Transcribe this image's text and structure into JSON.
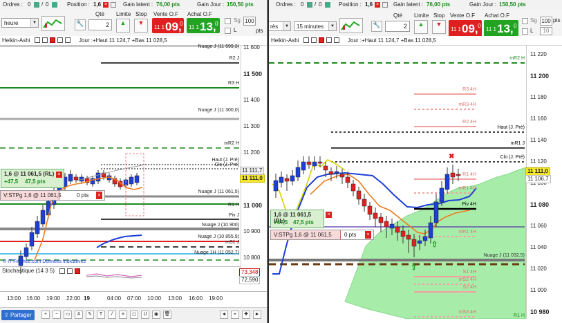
{
  "left": {
    "topbar": {
      "orders_label": "Ordres :",
      "orders_a": "0",
      "orders_b": "0",
      "position_label": "Position :",
      "position_val": "1,6",
      "gain_latent_label": "Gain latent :",
      "gain_latent_val": "76,00 pts",
      "gain_jour_label": "Gain Jour :",
      "gain_jour_val": "150,50 pts"
    },
    "toolbar": {
      "timeframe": "heure",
      "qte_label": "Qté",
      "qte_value": "2",
      "limite_label": "Limite",
      "stop_label": "Stop",
      "vente_label": "Vente O.F",
      "achat_label": "Achat O.F",
      "vente_small": "11 1",
      "vente_big": "09,",
      "vente_sup": "0",
      "achat_small": "11 1",
      "achat_big": "13,",
      "achat_sup": "0",
      "sg_label": "Sg",
      "l_label": "L",
      "pts_value": "100",
      "pts_label": "pts"
    },
    "chart_header": {
      "name": "Heikin-Ashi",
      "info": "Jour :+Haut 11 124,7 +Bas 11 028,5"
    },
    "axis_ticks": [
      "11 600",
      "11 500",
      "11 400",
      "11 300",
      "11 200",
      "11 100",
      "11 000",
      "10 900",
      "10 800"
    ],
    "price_flag": "11 111,0",
    "price_gray": "11 111,7",
    "price_red_a": "73,348",
    "price_red_b": "72,590",
    "levels": [
      "Nuage J (11 599,3)",
      "R2 J",
      "R3 H",
      "Nuage J (11 300,0)",
      "mR2 H",
      "Haut (J. Pré)",
      "Clo (J. Pré)",
      "Nuage J (11 061,5)",
      "R1 H",
      "Piv J",
      "Nuage J (10 900)",
      "Nuage J (10 855,9)",
      "mS1 J",
      "Nuage 1H (11 052,7)"
    ],
    "position": {
      "line1": "1,6 @ 11 061,5 (RL)",
      "gain": "+47,5",
      "gain_pts": "47,5 pts"
    },
    "stop": {
      "text": "V:STPg  1,6 @ 11 061,5",
      "pts": "0 pts"
    },
    "watermark": "© IT-Finance.com Données indicatives",
    "stoch_label": "Stochastique (14 3 5)",
    "times": [
      "13:00",
      "16:00",
      "19:00",
      "22:00",
      "19",
      "04:00",
      "07:00",
      "10:00",
      "13:00",
      "16:00",
      "19:00"
    ],
    "partager": "Partager"
  },
  "right": {
    "topbar": {
      "orders_label": "Ordres :",
      "orders_a": "0",
      "orders_b": "0",
      "position_label": "Position :",
      "position_val": "1,6",
      "gain_latent_label": "Gain latent :",
      "gain_latent_val": "76,00 pts",
      "gain_jour_label": "Gain Jour :",
      "gain_jour_val": "150,50 pts"
    },
    "toolbar": {
      "timeframe_left": "rès",
      "timeframe": "15 minutes",
      "qte_label": "Qté",
      "qte_value": "2",
      "limite_label": "Limite",
      "stop_label": "Stop",
      "vente_label": "Vente O.F",
      "achat_label": "Achat O.F",
      "vente_small": "11 1",
      "vente_big": "09,",
      "vente_sup": "0",
      "achat_small": "11 1",
      "achat_big": "13,",
      "achat_sup": "0",
      "sg_label": "Sg",
      "l_label": "L",
      "pts_value": "100",
      "pts_value2": "10",
      "pts_label": "pts"
    },
    "chart_header": {
      "name": "Heikin-Ashi",
      "info": "Jour :+Haut 11 124,7 +Bas 11 028,5"
    },
    "axis_ticks": [
      "11 220",
      "11 200",
      "11 180",
      "11 160",
      "11 140",
      "11 120",
      "11 100",
      "11 080",
      "11 060",
      "11 040",
      "11 020",
      "11 000",
      "10 980"
    ],
    "price_flag": "11 111,0",
    "price_gray": "11 106,7",
    "levels": [
      "mR2 H",
      "R3 4H",
      "mR3 4H",
      "R2 4H",
      "Haut (J. Pré)",
      "mR1 J",
      "Clo (J. Pré)",
      "R1 4H",
      "mR1 4H",
      "Piv 4H",
      "mR1 4H",
      "Nuage J (11 032,5)",
      "S1 4H",
      "mS2 4H",
      "S2 4H",
      "mS3 4H",
      "R1 H"
    ],
    "position": {
      "line1": "1,6 @ 11 061,5 (RL)",
      "gain": "+47,5",
      "gain_pts": "47,5 pts"
    },
    "stop": {
      "text": "V:STPg  1,6 @ 11 061,5",
      "pts": "0 pts"
    }
  }
}
